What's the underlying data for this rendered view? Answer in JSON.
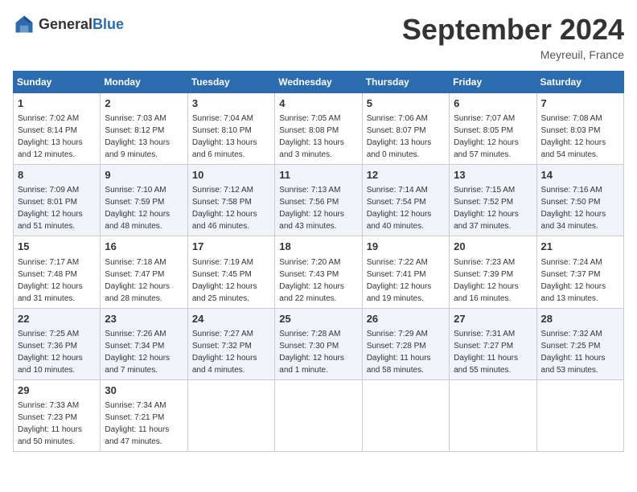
{
  "header": {
    "logo_general": "General",
    "logo_blue": "Blue",
    "title": "September 2024",
    "location": "Meyreuil, France"
  },
  "calendar": {
    "days_of_week": [
      "Sunday",
      "Monday",
      "Tuesday",
      "Wednesday",
      "Thursday",
      "Friday",
      "Saturday"
    ],
    "weeks": [
      [
        null,
        {
          "day": 2,
          "sunrise": "7:03 AM",
          "sunset": "8:12 PM",
          "daylight": "13 hours and 9 minutes."
        },
        {
          "day": 3,
          "sunrise": "7:04 AM",
          "sunset": "8:10 PM",
          "daylight": "13 hours and 6 minutes."
        },
        {
          "day": 4,
          "sunrise": "7:05 AM",
          "sunset": "8:08 PM",
          "daylight": "13 hours and 3 minutes."
        },
        {
          "day": 5,
          "sunrise": "7:06 AM",
          "sunset": "8:07 PM",
          "daylight": "13 hours and 0 minutes."
        },
        {
          "day": 6,
          "sunrise": "7:07 AM",
          "sunset": "8:05 PM",
          "daylight": "12 hours and 57 minutes."
        },
        {
          "day": 7,
          "sunrise": "7:08 AM",
          "sunset": "8:03 PM",
          "daylight": "12 hours and 54 minutes."
        }
      ],
      [
        {
          "day": 1,
          "sunrise": "7:02 AM",
          "sunset": "8:14 PM",
          "daylight": "13 hours and 12 minutes."
        },
        {
          "day": 8,
          "sunrise": "7:09 AM",
          "sunset": "8:01 PM",
          "daylight": "12 hours and 51 minutes."
        },
        {
          "day": 9,
          "sunrise": "7:10 AM",
          "sunset": "7:59 PM",
          "daylight": "12 hours and 48 minutes."
        },
        {
          "day": 10,
          "sunrise": "7:12 AM",
          "sunset": "7:58 PM",
          "daylight": "12 hours and 46 minutes."
        },
        {
          "day": 11,
          "sunrise": "7:13 AM",
          "sunset": "7:56 PM",
          "daylight": "12 hours and 43 minutes."
        },
        {
          "day": 12,
          "sunrise": "7:14 AM",
          "sunset": "7:54 PM",
          "daylight": "12 hours and 40 minutes."
        },
        {
          "day": 13,
          "sunrise": "7:15 AM",
          "sunset": "7:52 PM",
          "daylight": "12 hours and 37 minutes."
        },
        {
          "day": 14,
          "sunrise": "7:16 AM",
          "sunset": "7:50 PM",
          "daylight": "12 hours and 34 minutes."
        }
      ],
      [
        {
          "day": 15,
          "sunrise": "7:17 AM",
          "sunset": "7:48 PM",
          "daylight": "12 hours and 31 minutes."
        },
        {
          "day": 16,
          "sunrise": "7:18 AM",
          "sunset": "7:47 PM",
          "daylight": "12 hours and 28 minutes."
        },
        {
          "day": 17,
          "sunrise": "7:19 AM",
          "sunset": "7:45 PM",
          "daylight": "12 hours and 25 minutes."
        },
        {
          "day": 18,
          "sunrise": "7:20 AM",
          "sunset": "7:43 PM",
          "daylight": "12 hours and 22 minutes."
        },
        {
          "day": 19,
          "sunrise": "7:22 AM",
          "sunset": "7:41 PM",
          "daylight": "12 hours and 19 minutes."
        },
        {
          "day": 20,
          "sunrise": "7:23 AM",
          "sunset": "7:39 PM",
          "daylight": "12 hours and 16 minutes."
        },
        {
          "day": 21,
          "sunrise": "7:24 AM",
          "sunset": "7:37 PM",
          "daylight": "12 hours and 13 minutes."
        }
      ],
      [
        {
          "day": 22,
          "sunrise": "7:25 AM",
          "sunset": "7:36 PM",
          "daylight": "12 hours and 10 minutes."
        },
        {
          "day": 23,
          "sunrise": "7:26 AM",
          "sunset": "7:34 PM",
          "daylight": "12 hours and 7 minutes."
        },
        {
          "day": 24,
          "sunrise": "7:27 AM",
          "sunset": "7:32 PM",
          "daylight": "12 hours and 4 minutes."
        },
        {
          "day": 25,
          "sunrise": "7:28 AM",
          "sunset": "7:30 PM",
          "daylight": "12 hours and 1 minute."
        },
        {
          "day": 26,
          "sunrise": "7:29 AM",
          "sunset": "7:28 PM",
          "daylight": "11 hours and 58 minutes."
        },
        {
          "day": 27,
          "sunrise": "7:31 AM",
          "sunset": "7:27 PM",
          "daylight": "11 hours and 55 minutes."
        },
        {
          "day": 28,
          "sunrise": "7:32 AM",
          "sunset": "7:25 PM",
          "daylight": "11 hours and 53 minutes."
        }
      ],
      [
        {
          "day": 29,
          "sunrise": "7:33 AM",
          "sunset": "7:23 PM",
          "daylight": "11 hours and 50 minutes."
        },
        {
          "day": 30,
          "sunrise": "7:34 AM",
          "sunset": "7:21 PM",
          "daylight": "11 hours and 47 minutes."
        },
        null,
        null,
        null,
        null,
        null
      ]
    ]
  }
}
